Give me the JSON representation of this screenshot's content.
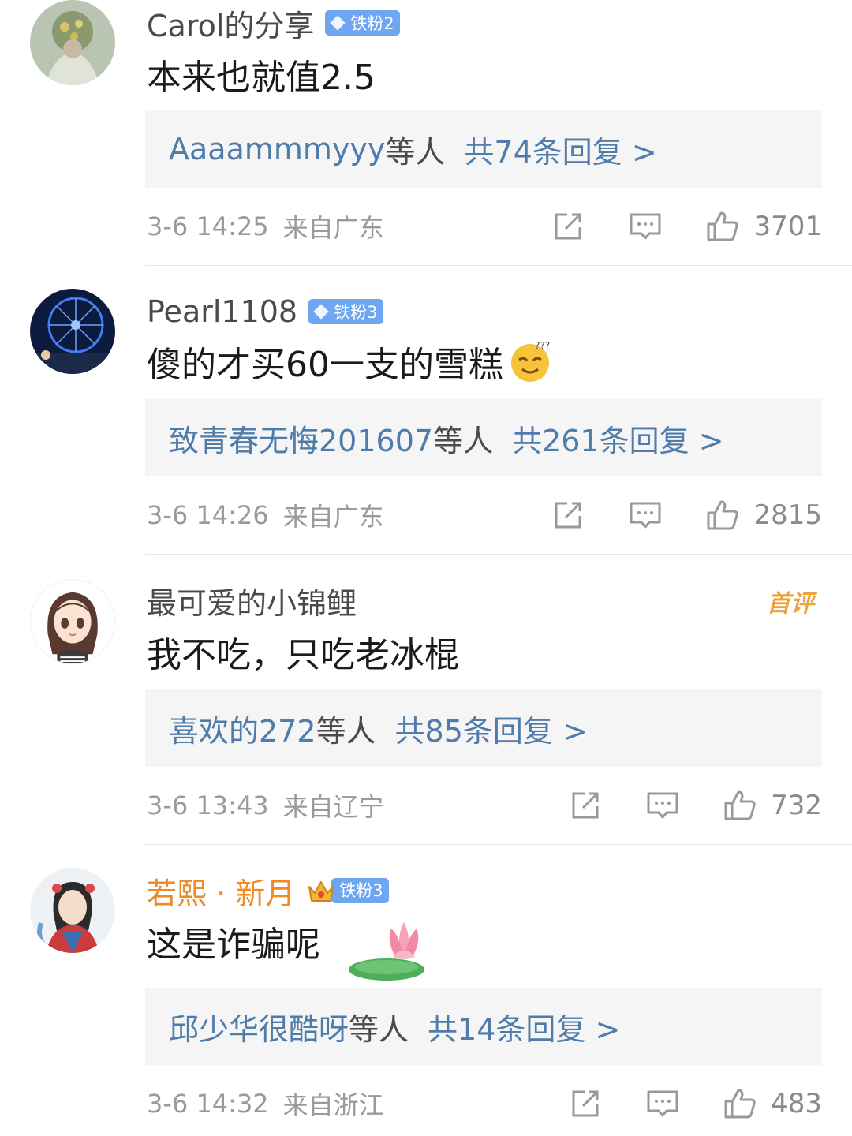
{
  "comments": [
    {
      "username": "Carol的分享",
      "badge": "铁粉2",
      "content": "本来也就值2.5",
      "reply_users": "Aaaammmyyy",
      "reply_suffix": "等人",
      "reply_count": "共74条回复 >",
      "time": "3-6 14:25",
      "location": "来自广东",
      "likes": "3701"
    },
    {
      "username": "Pearl1108",
      "badge": "铁粉3",
      "content": "傻的才买60一支的雪糕",
      "emoji": "thinking-face-icon",
      "reply_users": "致青春无悔201607",
      "reply_suffix": "等人",
      "reply_count": "共261条回复 >",
      "time": "3-6 14:26",
      "location": "来自广东",
      "likes": "2815"
    },
    {
      "username": "最可爱的小锦鲤",
      "first_tag": "首评",
      "content": "我不吃，只吃老冰棍",
      "reply_users": "喜欢的272",
      "reply_suffix": "等人",
      "reply_count": "共85条回复 >",
      "time": "3-6 13:43",
      "location": "来自辽宁",
      "likes": "732"
    },
    {
      "username": "若熙 · 新月",
      "badge": "铁粉3",
      "content": "这是诈骗呢",
      "emoji": "lotus-icon",
      "reply_users": "邱少华很酷呀",
      "reply_suffix": "等人",
      "reply_count": "共14条回复 >",
      "time": "3-6 14:32",
      "location": "来自浙江",
      "likes": "483"
    }
  ],
  "colors": {
    "link_blue": "#4f7cab",
    "badge_blue": "#6fa6f2",
    "vip_orange": "#f08a24",
    "meta_gray": "#9a9a9a"
  }
}
